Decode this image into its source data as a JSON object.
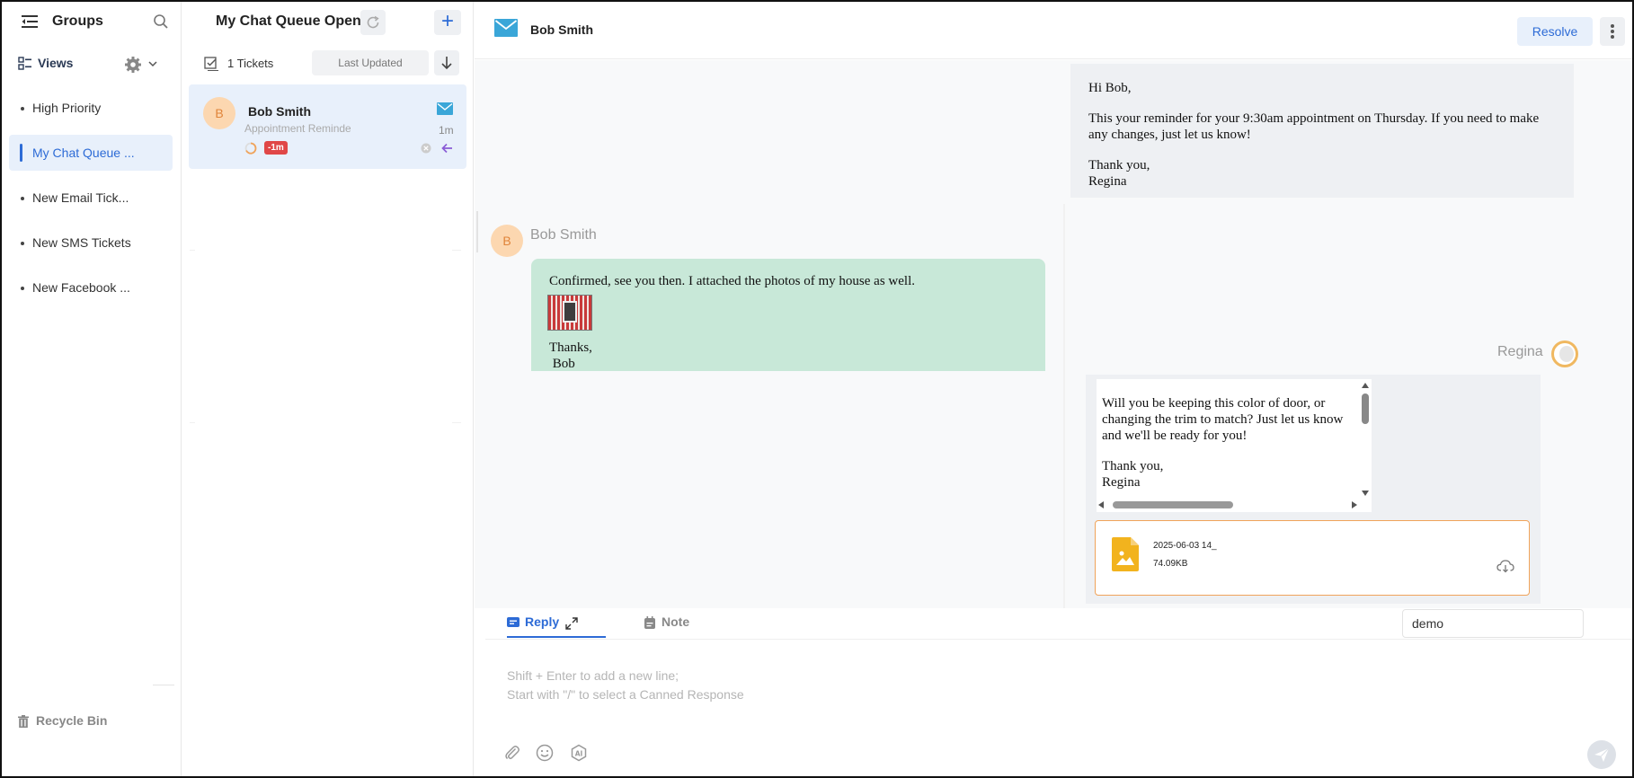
{
  "nav": {
    "title": "Groups",
    "views_label": "Views",
    "items": [
      {
        "label": "High Priority",
        "active": false
      },
      {
        "label": "My Chat Queue ...",
        "active": true
      },
      {
        "label": "New Email Tick...",
        "active": false
      },
      {
        "label": "New SMS Tickets",
        "active": false
      },
      {
        "label": "New Facebook ...",
        "active": false
      }
    ],
    "recycle_bin": "Recycle Bin"
  },
  "list": {
    "title": "My Chat Queue Open",
    "ticket_count": "1 Tickets",
    "sort_label": "Last Updated",
    "tickets": [
      {
        "avatar": "B",
        "name": "Bob Smith",
        "subject": "Appointment Reminder",
        "time": "1m",
        "badge": "-1m"
      }
    ]
  },
  "conversation": {
    "contact_name": "Bob Smith",
    "resolve_label": "Resolve",
    "messages": {
      "agent_first": {
        "greeting": "Hi Bob,",
        "body": "This your reminder for your 9:30am appointment on Thursday. If you need to make any changes, just let us know!",
        "signoff": "Thank you,",
        "signature": "Regina"
      },
      "customer": {
        "sender": "Bob Smith",
        "avatar": "B",
        "line1": "Confirmed, see you then.  I attached the photos of my house as well.",
        "thanks": "Thanks,",
        "signature": " Bob"
      },
      "agent_second": {
        "sender": "Regina",
        "body": "Will you be keeping this color of door, or changing the trim to match?  Just let us know and we'll be ready for you!",
        "signoff": "Thank you,",
        "signature": "Regina",
        "attachment_name": "2025-06-03 14_",
        "attachment_size": "74.09KB"
      }
    }
  },
  "composer": {
    "reply_tab": "Reply",
    "note_tab": "Note",
    "channel_value": "demo",
    "placeholder": "Shift + Enter to add a new line;\nStart with \"/\" to select a Canned Response"
  },
  "colors": {
    "accent": "#2d6bd6",
    "customer_bubble": "#c8e8d8",
    "agent_bubble": "#eef0f3",
    "badge_red": "#e04747",
    "email_blue": "#3aa6d8",
    "attachment_orange": "#f0a35a"
  },
  "icons": {
    "menu": "menu-collapse-icon",
    "search": "search-icon",
    "gear": "gear-icon",
    "email": "email-icon",
    "attachment": "paperclip-icon",
    "emoji": "emoji-icon",
    "ai": "ai-icon",
    "send": "send-icon"
  }
}
